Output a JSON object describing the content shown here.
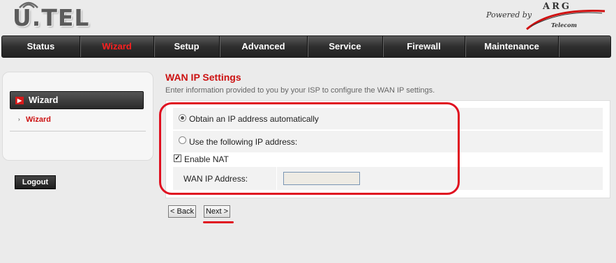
{
  "header": {
    "logo": "U.TEL",
    "powered_by": "Powered by",
    "brand": "ARG",
    "brand_sub": "Telecom"
  },
  "nav": {
    "items": [
      "Status",
      "Wizard",
      "Setup",
      "Advanced",
      "Service",
      "Firewall",
      "Maintenance"
    ],
    "active": "Wizard"
  },
  "sidebar": {
    "heading": "Wizard",
    "items": [
      {
        "label": "Wizard"
      }
    ],
    "logout_label": "Logout"
  },
  "main": {
    "title": "WAN IP Settings",
    "subtitle": "Enter information provided to you by your ISP to configure the WAN IP settings.",
    "options": {
      "auto_label": "Obtain an IP address automatically",
      "auto_checked": true,
      "manual_label": "Use the following IP address:",
      "manual_checked": false
    },
    "nat": {
      "label": "Enable NAT",
      "checked": true
    },
    "wan_ip": {
      "label": "WAN IP Address:",
      "value": ""
    },
    "buttons": {
      "back": "< Back",
      "next": "Next >"
    }
  },
  "colors": {
    "accent": "#cc1111",
    "annotation": "#e01020",
    "nav_bg": "#2e2e2e"
  },
  "icons": {
    "logo_wave": "wifi-wave-icon",
    "sidebar_heading": "chevron-right-icon",
    "sidebar_bullet": "small-chevron-icon",
    "logo_swoosh": "swoosh-icon"
  }
}
